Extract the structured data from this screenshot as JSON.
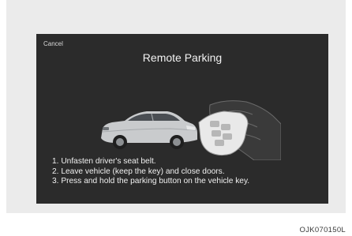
{
  "screen": {
    "cancel_label": "Cancel",
    "title": "Remote Parking",
    "steps": [
      "1. Unfasten driver's seat belt.",
      "2. Leave vehicle (keep the key) and close doors.",
      "3. Press and hold the parking button on the vehicle key."
    ]
  },
  "figure_code": "OJK070150L",
  "illustration": {
    "icons": [
      "car-icon",
      "hand-icon",
      "vehicle-key-icon"
    ]
  },
  "colors": {
    "screen_background": "#2b2b2b",
    "panel_background": "#ebebeb",
    "text": "#f0f0f0"
  }
}
